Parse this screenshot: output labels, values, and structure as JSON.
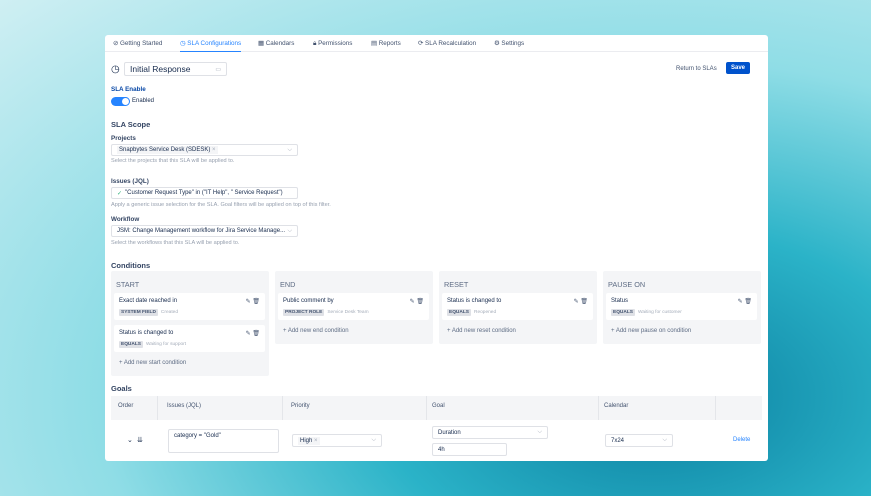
{
  "tabs": [
    "Getting Started",
    "SLA Configurations",
    "Calendars",
    "Permissions",
    "Reports",
    "SLA Recalculation",
    "Settings"
  ],
  "sla_name": "Initial Response",
  "return_label": "Return to SLAs",
  "save_label": "Save",
  "sla_enable": {
    "label": "SLA Enable",
    "state": "Enabled",
    "on": true
  },
  "scope_title": "SLA Scope",
  "projects": {
    "label": "Projects",
    "value": "Snapbytes Service Desk (SDESK)",
    "help": "Select the projects that this SLA will be applied to."
  },
  "issues": {
    "label": "Issues (JQL)",
    "value": "\"Customer Request Type\" in (\"IT Help\", \" Service Request\")",
    "help": "Apply a generic issue selection for the SLA. Goal filters will be applied on top of this filter."
  },
  "workflow": {
    "label": "Workflow",
    "value": "JSM: Change Management workflow for Jira Service Manage...",
    "help": "Select the workflows that this SLA will be applied to."
  },
  "conditions_title": "Conditions",
  "columns": [
    {
      "title": "START",
      "items": [
        {
          "title": "Exact date reached in",
          "tag": "SYSTEM FIELD",
          "value": "Created"
        },
        {
          "title": "Status is changed to",
          "tag": "EQUALS",
          "value": "Waiting for support"
        }
      ],
      "add": "Add new start condition"
    },
    {
      "title": "END",
      "items": [
        {
          "title": "Public comment by",
          "tag": "PROJECT ROLE",
          "value": "Service Desk Team"
        }
      ],
      "add": "Add new end condition"
    },
    {
      "title": "RESET",
      "items": [
        {
          "title": "Status is changed to",
          "tag": "EQUALS",
          "value": "Reopened"
        }
      ],
      "add": "Add new reset condition"
    },
    {
      "title": "PAUSE ON",
      "items": [
        {
          "title": "Status",
          "tag": "EQUALS",
          "value": "Waiting for customer"
        }
      ],
      "add": "Add new pause on condition"
    }
  ],
  "goals": {
    "title": "Goals",
    "headers": [
      "Order",
      "Issues (JQL)",
      "Priority",
      "Goal",
      "Calendar"
    ],
    "row": {
      "jql": "category = \"Gold\"",
      "priority": "High",
      "goal_type": "Duration",
      "goal_value": "4h",
      "calendar": "7x24",
      "delete": "Delete"
    }
  }
}
